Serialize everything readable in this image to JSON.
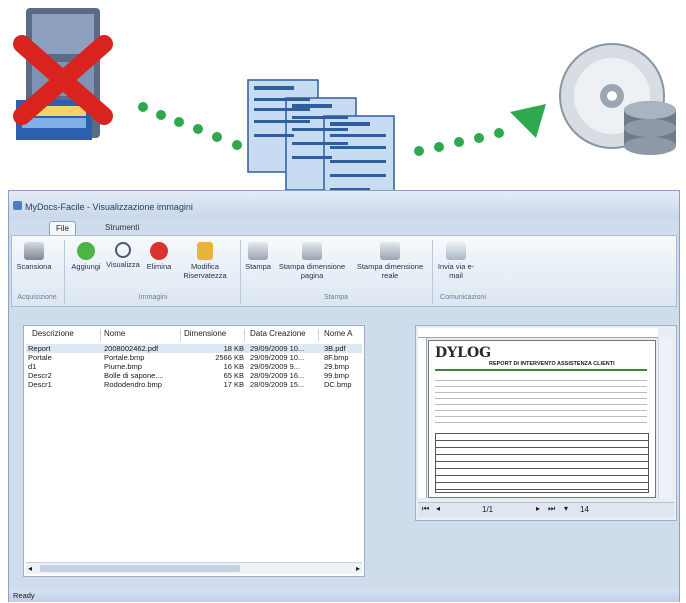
{
  "window": {
    "title": "MyDocs-Facile - Visualizzazione immagini"
  },
  "tabs": [
    {
      "label": "File"
    },
    {
      "label": "Strumenti"
    }
  ],
  "ribbon": {
    "acquisizione": {
      "scansiona": "Scansiona",
      "group": "Acquisizione"
    },
    "immagini": {
      "aggiungi": "Aggiungi",
      "visualizza": "Visualizza",
      "elimina": "Elimina",
      "modifica": "Modifica Riservatezza",
      "group": "Immagini"
    },
    "stampa": {
      "stampa": "Stampa",
      "dim_pagina": "Stampa dimensione pagina",
      "dim_reale": "Stampa dimensione reale",
      "group": "Stampa"
    },
    "comunicazioni": {
      "invia": "Invia via e-mail",
      "group": "Comunicazioni"
    }
  },
  "list": {
    "headers": [
      "Descrizione",
      "Nome",
      "Dimensione",
      "Data Creazione",
      "Nome A"
    ],
    "rows": [
      {
        "descrizione": "Report",
        "nome": "2008002462.pdf",
        "dimensione": "18 KB",
        "data": "29/09/2009 10...",
        "nomea": "3B.pdf"
      },
      {
        "descrizione": "Portale",
        "nome": "Portale.bmp",
        "dimensione": "2566 KB",
        "data": "29/09/2009 10...",
        "nomea": "8F.bmp"
      },
      {
        "descrizione": "d1",
        "nome": "Piume.bmp",
        "dimensione": "16 KB",
        "data": "29/09/2009 9...",
        "nomea": "29.bmp"
      },
      {
        "descrizione": "Descr2",
        "nome": "Bolle di sapone....",
        "dimensione": "65 KB",
        "data": "28/09/2009 16...",
        "nomea": "99.bmp"
      },
      {
        "descrizione": "Descr1",
        "nome": "Rododendro.bmp",
        "dimensione": "17 KB",
        "data": "28/09/2009 15...",
        "nomea": "DC.bmp"
      }
    ]
  },
  "preview": {
    "logo": "DYLOG",
    "doc_title": "REPORT DI INTERVENTO ASSISTENZA CLIENTI",
    "page_indicator": "1/1",
    "zoom": "14"
  },
  "status": {
    "text": "Ready"
  },
  "colors": {
    "accent": "#2fa84f",
    "window_bg": "#cfdcec",
    "selected_row": "#dde8f5"
  }
}
